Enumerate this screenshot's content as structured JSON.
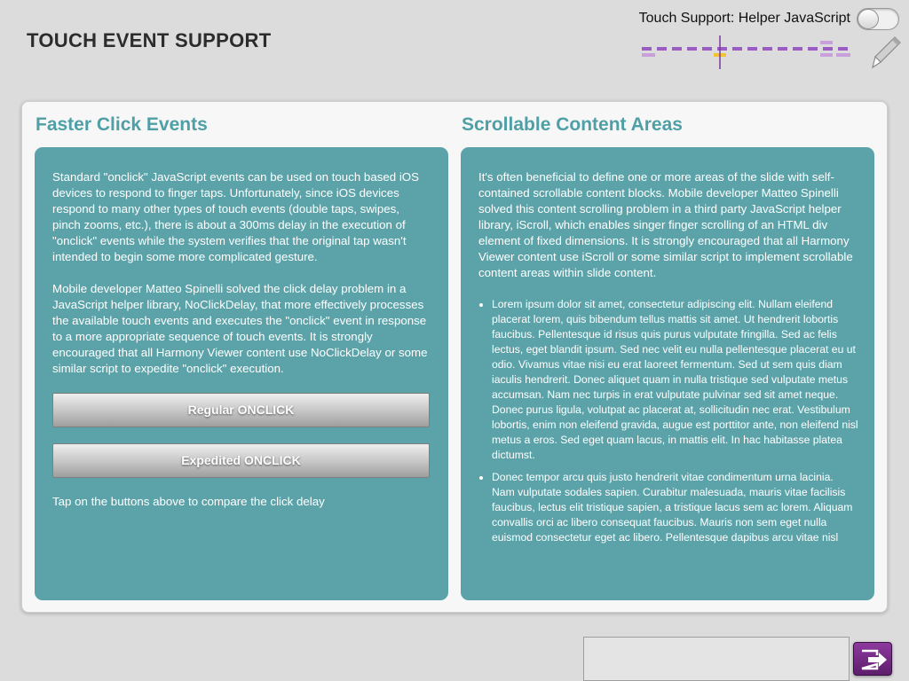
{
  "header": {
    "title": "TOUCH EVENT SUPPORT",
    "touch_support_label": "Touch Support: Helper JavaScript",
    "toggle_state": "off"
  },
  "icons": {
    "toggle": "toggle-switch-icon",
    "nav": "slide-navigation-icon",
    "pen": "pen-icon",
    "exit": "exit-icon"
  },
  "colors": {
    "accent": "#5ba3a9",
    "heading": "#4f9fa6",
    "nav_track": "#9b5cc4",
    "nav_marker": "#f2c230",
    "exit_button": "#6a2a7a"
  },
  "left": {
    "title": "Faster Click Events",
    "para1": "Standard \"onclick\" JavaScript events can be used on touch based iOS devices to respond to finger taps. Unfortunately, since iOS devices respond to many other types of touch events (double taps, swipes, pinch zooms, etc.), there is about a 300ms delay in the execution of \"onclick\" events while the system verifies that the original tap wasn't intended to begin some more complicated gesture.",
    "para2": "Mobile developer Matteo Spinelli solved the click delay problem in a JavaScript helper library, NoClickDelay, that more effectively processes the available touch events and executes the \"onclick\" event in response to a more appropriate sequence of touch events. It is strongly encouraged that all Harmony Viewer content use NoClickDelay or some similar script to expedite \"onclick\" execution.",
    "button1": "Regular ONCLICK",
    "button2": "Expedited ONCLICK",
    "hint": "Tap on the buttons above to compare the click delay"
  },
  "right": {
    "title": "Scrollable Content Areas",
    "intro": "It's often beneficial to define one or more areas of the slide with self-contained scrollable content blocks. Mobile developer Matteo Spinelli solved this content scrolling problem in a third party JavaScript helper library, iScroll, which enables singer finger scrolling of an HTML div element of fixed dimensions. It is strongly encouraged that all Harmony Viewer content use iScroll or some similar script to implement scrollable content areas within slide content.",
    "items": [
      "Lorem ipsum dolor sit amet, consectetur adipiscing elit. Nullam eleifend placerat lorem, quis bibendum tellus mattis sit amet. Ut hendrerit lobortis faucibus. Pellentesque id risus quis purus vulputate fringilla. Sed ac felis lectus, eget blandit ipsum. Sed nec velit eu nulla pellentesque placerat eu ut odio. Vivamus vitae nisi eu erat laoreet fermentum. Sed ut sem quis diam iaculis hendrerit. Donec aliquet quam in nulla tristique sed vulputate metus accumsan. Nam nec turpis in erat vulputate pulvinar sed sit amet neque. Donec purus ligula, volutpat ac placerat at, sollicitudin nec erat. Vestibulum lobortis, enim non eleifend gravida, augue est porttitor ante, non eleifend nisl metus a eros. Sed eget quam lacus, in mattis elit. In hac habitasse platea dictumst.",
      "Donec tempor arcu quis justo hendrerit vitae condimentum urna lacinia. Nam vulputate sodales sapien. Curabitur malesuada, mauris vitae facilisis faucibus, lectus elit tristique sapien, a tristique lacus sem ac lorem. Aliquam convallis orci ac libero consequat faucibus. Mauris non sem eget nulla euismod consectetur eget ac libero. Pellentesque dapibus arcu vitae nisl"
    ]
  }
}
